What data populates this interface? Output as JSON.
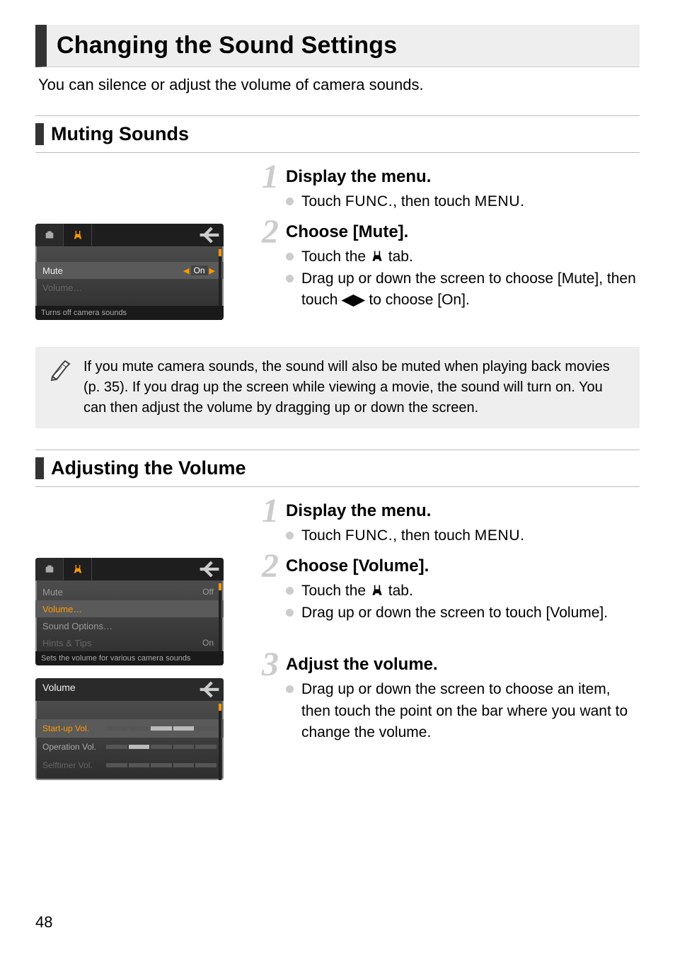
{
  "page_number": "48",
  "title": "Changing the Sound Settings",
  "intro": "You can silence or adjust the volume of camera sounds.",
  "section1": {
    "heading": "Muting Sounds",
    "step1": {
      "title": "Display the menu.",
      "l1a": "Touch ",
      "l1b": ", then touch ",
      "l1c": "."
    },
    "step2": {
      "title": "Choose [Mute].",
      "l1a": "Touch the ",
      "l1b": " tab.",
      "l2a": "Drag up or down the screen to choose [Mute], then touch ",
      "l2b": " to choose [On]."
    },
    "note": "If you mute camera sounds, the sound will also be muted when playing back movies (p. 35). If you drag up the screen while viewing a movie, the sound will turn on. You can then adjust the volume by dragging up or down the screen."
  },
  "section2": {
    "heading": "Adjusting the Volume",
    "step1": {
      "title": "Display the menu.",
      "l1a": "Touch ",
      "l1b": ", then touch ",
      "l1c": "."
    },
    "step2": {
      "title": "Choose [Volume].",
      "l1a": "Touch the ",
      "l1b": " tab.",
      "l2": "Drag up or down the screen to touch [Volume]."
    },
    "step3": {
      "title": "Adjust the volume.",
      "l1": "Drag up or down the screen to choose an item, then touch the point on the bar where you want to change the volume."
    }
  },
  "glyph": {
    "func": "FUNC.",
    "menu": "MENU",
    "tools": "⚒",
    "leftright": "◀▶"
  },
  "cam1": {
    "row1_label": "Mute",
    "row1_value": "On",
    "row2_label": "Volume…",
    "hint": "Turns off camera sounds"
  },
  "cam2": {
    "row1_label": "Mute",
    "row1_value": "Off",
    "row2_label": "Volume…",
    "row3_label": "Sound Options…",
    "row4_label": "Hints & Tips",
    "row4_value": "On",
    "hint": "Sets the volume for various camera sounds"
  },
  "cam3": {
    "title": "Volume",
    "row1": "Start-up Vol.",
    "row2": "Operation Vol.",
    "row3": "Selftimer Vol."
  }
}
